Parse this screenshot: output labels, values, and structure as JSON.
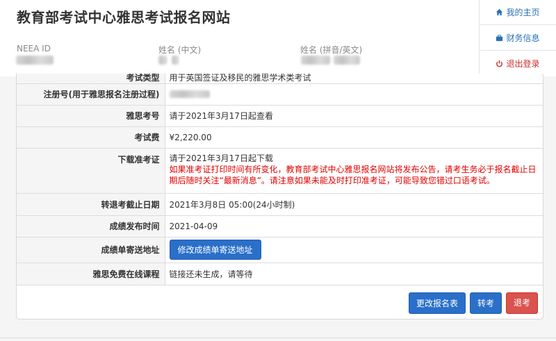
{
  "header": {
    "title": "教育部考试中心雅思考试报名网站",
    "labels": [
      "NEEA ID",
      "姓名 (中文)",
      "姓名 (拼音/英文)"
    ]
  },
  "side_menu": [
    {
      "label": "我的主页",
      "icon": "home-icon"
    },
    {
      "label": "财务信息",
      "icon": "briefcase-icon"
    },
    {
      "label": "退出登录",
      "icon": "power-icon"
    }
  ],
  "rows": [
    {
      "label": "考试类型",
      "value": "用于英国签证及移民的雅思学术类考试"
    },
    {
      "label": "注册号(用于雅思报名注册过程)",
      "value": ""
    },
    {
      "label": "雅思考号",
      "value": "请于2021年3月17日起查看"
    },
    {
      "label": "考试费",
      "value": "¥2,220.00"
    },
    {
      "label": "下载准考证",
      "value": "请于2021年3月17日起下载",
      "note": "如果准考证打印时间有所变化，教育部考试中心雅思报名网站将发布公告，请考生务必于报名截止日期后随时关注“最新消息”。请注意如果未能及时打印准考证，可能导致您错过口语考试。"
    },
    {
      "label": "转退考截止日期",
      "value": "2021年3月8日 05:00(24小时制)"
    },
    {
      "label": "成绩发布时间",
      "value": "2021-04-09"
    },
    {
      "label": "成绩单寄送地址",
      "button": "修改成绩单寄送地址"
    },
    {
      "label": "雅思免费在线课程",
      "value": "链接还未生成，请等待"
    }
  ],
  "actions": {
    "change": "更改报名表",
    "transfer": "转考",
    "withdraw": "退考"
  },
  "colors": {
    "primary": "#2a6fc9",
    "danger": "#d9534f",
    "warning_text": "#e10000"
  }
}
